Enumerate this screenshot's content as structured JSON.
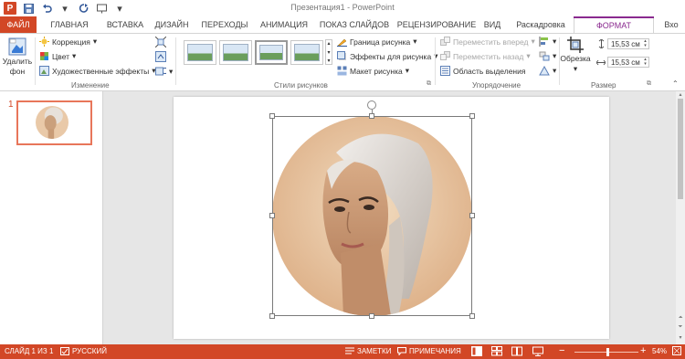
{
  "app": {
    "title": "Презентация1 - PowerPoint",
    "logo_letter": "P"
  },
  "tabs": [
    "ФАЙЛ",
    "ГЛАВНАЯ",
    "ВСТАВКА",
    "ДИЗАЙН",
    "ПЕРЕХОДЫ",
    "АНИМАЦИЯ",
    "ПОКАЗ СЛАЙДОВ",
    "РЕЦЕНЗИРОВАНИЕ",
    "ВИД",
    "Раскадровка",
    "ФОРМАТ",
    "Вхо"
  ],
  "ribbon": {
    "remove_bg": {
      "line1": "Удалить",
      "line2": "фон"
    },
    "adjust": {
      "correction": "Коррекция",
      "color": "Цвет",
      "artistic": "Художественные эффекты",
      "label": "Изменение"
    },
    "styles": {
      "label": "Стили рисунков",
      "border": "Граница рисунка",
      "effects": "Эффекты для рисунка",
      "layout": "Макет рисунка"
    },
    "arrange": {
      "forward": "Переместить вперед",
      "backward": "Переместить назад",
      "selection": "Область выделения",
      "label": "Упорядочение"
    },
    "size": {
      "crop": "Обрезка",
      "height": "15,53 см",
      "width": "15,53 см",
      "label": "Размер"
    }
  },
  "thumbnails": {
    "slide_number": "1"
  },
  "status": {
    "slide": "СЛАЙД 1 ИЗ 1",
    "language": "РУССКИЙ",
    "notes": "ЗАМЕТКИ",
    "comments": "ПРИМЕЧАНИЯ",
    "zoom": "54%"
  },
  "colors": {
    "accent": "#d24726",
    "format_tab": "#8a2a8f"
  },
  "icons": [
    "undo-icon",
    "redo-icon",
    "save-icon",
    "presentation-icon",
    "remove-background-icon",
    "correction-icon",
    "color-icon",
    "artistic-effects-icon",
    "crop-icon",
    "rotate-handle-icon",
    "notes-icon",
    "comments-icon"
  ]
}
